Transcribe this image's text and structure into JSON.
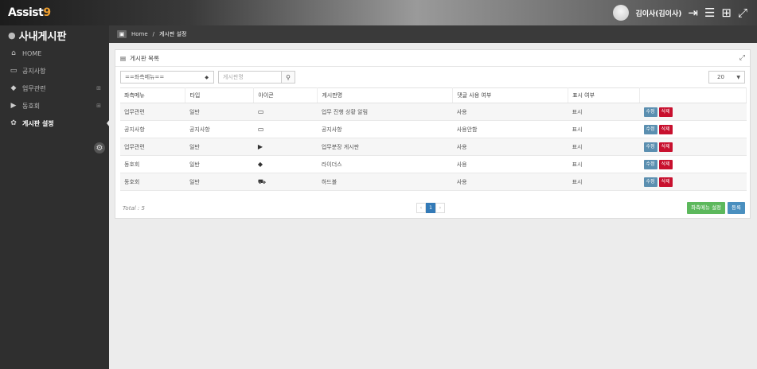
{
  "app": {
    "logo_main": "Assist",
    "logo_accent": "9"
  },
  "user": {
    "name": "김이사(김이사)"
  },
  "sidebar": {
    "title": "사내게시판",
    "items": [
      {
        "icon": "home-icon",
        "glyph": "⌂",
        "label": "HOME",
        "expandable": false
      },
      {
        "icon": "calendar-icon",
        "glyph": "▭",
        "label": "공지사항",
        "expandable": false
      },
      {
        "icon": "tag-icon",
        "glyph": "◆",
        "label": "업무관련",
        "expandable": true
      },
      {
        "icon": "flag-icon",
        "glyph": "▶",
        "label": "동호회",
        "expandable": true
      },
      {
        "icon": "gear-icon",
        "glyph": "✿",
        "label": "게시판 설정",
        "expandable": false
      }
    ]
  },
  "breadcrumb": {
    "home": "Home",
    "separator": "/",
    "current": "게시판 설정"
  },
  "panel": {
    "title": "게시판 목록",
    "filters": {
      "menu_select": "==좌측메뉴==",
      "name_placeholder": "게시판명",
      "page_size": "20"
    },
    "columns": [
      "좌측메뉴",
      "타입",
      "아이콘",
      "게시판명",
      "댓글 사용 여부",
      "표시 여부",
      ""
    ],
    "rows": [
      {
        "menu": "업무관련",
        "type": "일반",
        "icon": "calendar-icon",
        "glyph": "▭",
        "name": "업무 진행 상황 알림",
        "comment": "사용",
        "display": "표시"
      },
      {
        "menu": "공지사항",
        "type": "공지사항",
        "icon": "calendar-icon",
        "glyph": "▭",
        "name": "공지사항",
        "comment": "사용안함",
        "display": "표시"
      },
      {
        "menu": "업무관련",
        "type": "일반",
        "icon": "flag-icon",
        "glyph": "▶",
        "name": "업무분장 게시판",
        "comment": "사용",
        "display": "표시"
      },
      {
        "menu": "동호회",
        "type": "일반",
        "icon": "tag-icon",
        "glyph": "◆",
        "name": "라이더스",
        "comment": "사용",
        "display": "표시"
      },
      {
        "menu": "동호회",
        "type": "일반",
        "icon": "car-icon",
        "glyph": "⛟",
        "name": "하드볼",
        "comment": "사용",
        "display": "표시"
      }
    ],
    "row_actions": {
      "edit": "수정",
      "delete": "삭제"
    },
    "footer": {
      "total": "Total : 5",
      "pager_prev": "‹",
      "pager_current": "1",
      "pager_next": "›",
      "left_menu_button": "좌측메뉴 설정",
      "register_button": "등록"
    }
  }
}
